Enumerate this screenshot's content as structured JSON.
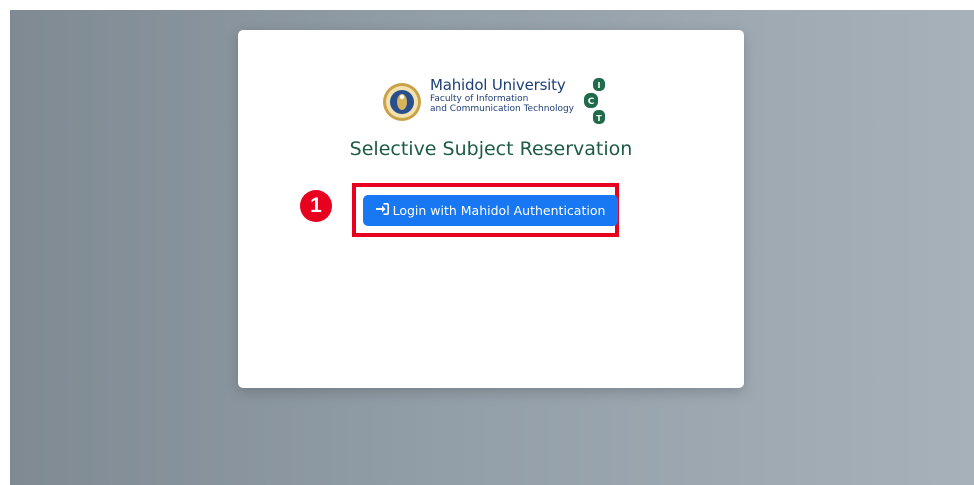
{
  "header": {
    "university_name": "Mahidol University",
    "faculty_line1": "Faculty of Information",
    "faculty_line2": "and Communication Technology",
    "ict_letters": [
      "I",
      "C",
      "T"
    ]
  },
  "main": {
    "title": "Selective Subject Reservation",
    "login_button": {
      "label": "Login with Mahidol Authentication",
      "icon": "sign-in-icon"
    }
  },
  "annotation": {
    "step_number": "1"
  },
  "colors": {
    "primary_button": "#1877f2",
    "title_green": "#1d5b46",
    "university_blue": "#1f3f77",
    "annotation_red": "#e8001f",
    "ict_green": "#1f6b4a"
  }
}
